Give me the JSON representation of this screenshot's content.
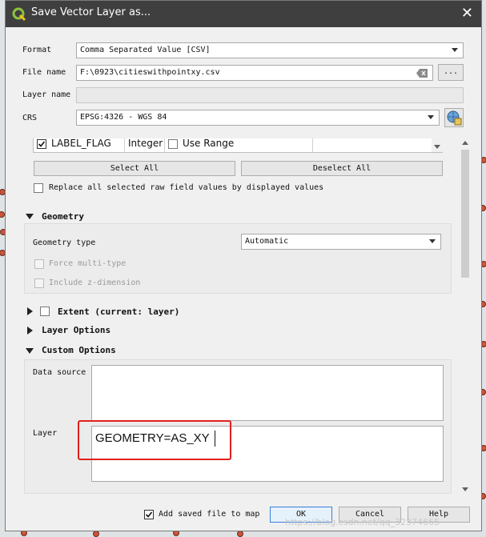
{
  "window": {
    "title": "Save Vector Layer as...",
    "close_glyph": "✕"
  },
  "form": {
    "format_label": "Format",
    "format_value": "Comma Separated Value [CSV]",
    "filename_label": "File name",
    "filename_value": "F:\\0923\\citieswithpointxy.csv",
    "browse_label": "...",
    "layername_label": "Layer name",
    "layername_value": "",
    "crs_label": "CRS",
    "crs_value": "EPSG:4326 - WGS 84"
  },
  "fields_table": {
    "row_field": "LABEL_FLAG",
    "row_type": "Integer",
    "row_option": "Use Range"
  },
  "select_all_label": "Select All",
  "deselect_all_label": "Deselect All",
  "replace_label": "Replace all selected raw field values by displayed values",
  "geometry": {
    "title": "Geometry",
    "type_label": "Geometry type",
    "type_value": "Automatic",
    "force_multi_label": "Force multi-type",
    "include_z_label": "Include z-dimension"
  },
  "extent_label": "Extent (current: layer)",
  "layer_options_label": "Layer Options",
  "custom_options": {
    "title": "Custom Options",
    "datasource_label": "Data source",
    "layer_label": "Layer",
    "layer_value": "GEOMETRY=AS_XY"
  },
  "footer": {
    "add_to_map_label": "Add saved file to map",
    "ok_label": "OK",
    "cancel_label": "Cancel",
    "help_label": "Help"
  },
  "watermark": "https://blog.csdn.net/qq_32374665",
  "colors": {
    "titlebar": "#3f3f3f",
    "highlight": "#e0201e",
    "ok_border": "#3c7fd6"
  }
}
